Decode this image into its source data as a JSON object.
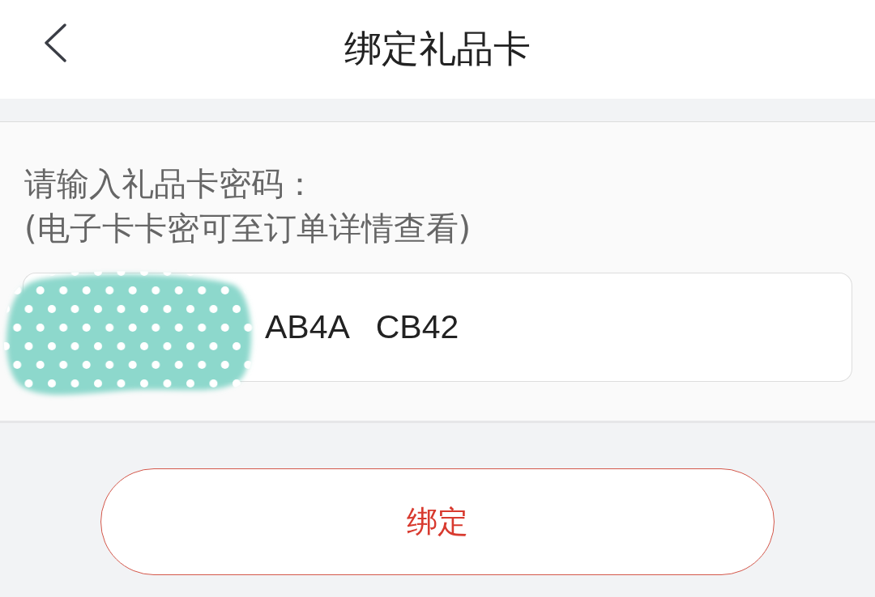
{
  "header": {
    "title": "绑定礼品卡"
  },
  "form": {
    "prompt": "请输入礼品卡密码：",
    "hint": "(电子卡卡密可至订单详情查看)",
    "code_field": {
      "value": "AB4A   CB42"
    }
  },
  "submit_button": {
    "label": "绑定"
  }
}
